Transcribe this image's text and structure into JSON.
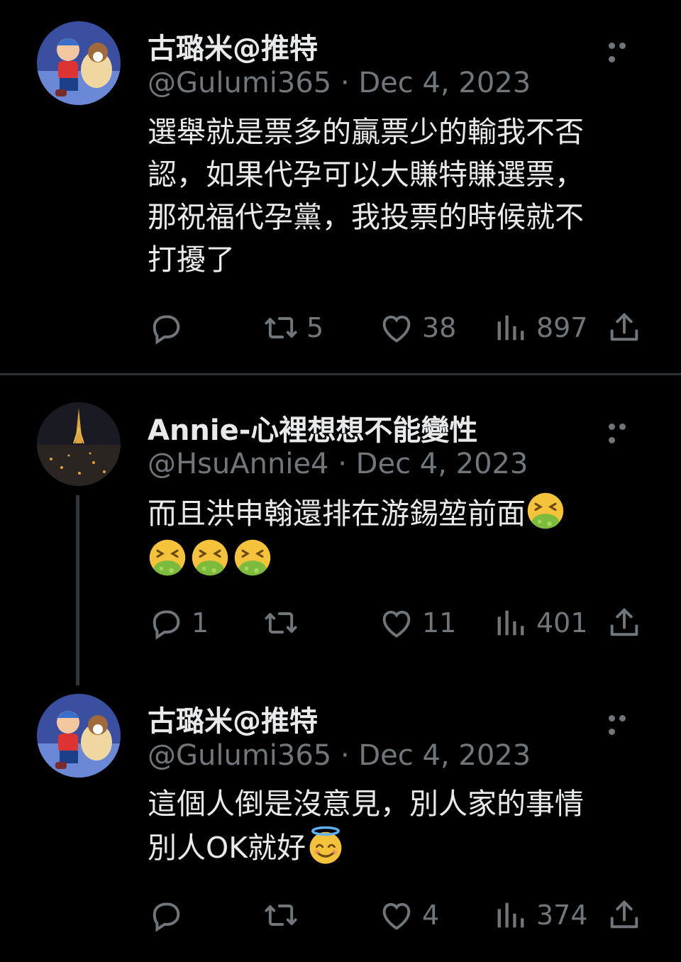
{
  "tweets": [
    {
      "name": "古璐米@推特",
      "handle_date": "@Gulumi365 · Dec 4, 2023",
      "lines": [
        "選舉就是票多的贏票少的輸我不否",
        "認，如果代孕可以大賺特賺選票，",
        "那祝福代孕黨，我投票的時候就不",
        "打擾了"
      ],
      "replies": "",
      "reposts": "5",
      "likes": "38",
      "views": "897"
    },
    {
      "name": "Annie-心裡想想不能變性",
      "handle_date": "@HsuAnnie4 · Dec 4, 2023",
      "lines": [
        "而且洪申翰還排在游錫堃前面"
      ],
      "emoji": [
        "face-vomiting-icon",
        "face-vomiting-icon",
        "face-vomiting-icon",
        "face-vomiting-icon"
      ],
      "replies": "1",
      "reposts": "",
      "likes": "11",
      "views": "401"
    },
    {
      "name": "古璐米@推特",
      "handle_date": "@Gulumi365 · Dec 4, 2023",
      "lines": [
        "這個人倒是沒意見，別人家的事情",
        "別人OK就好"
      ],
      "emoji": [
        "smiling-face-with-halo-icon"
      ],
      "replies": "",
      "reposts": "",
      "likes": "4",
      "views": "374"
    }
  ],
  "colors": {
    "background": "#000000",
    "text": "#e7e9ea",
    "muted": "#71767b",
    "divider": "#2f3336"
  }
}
